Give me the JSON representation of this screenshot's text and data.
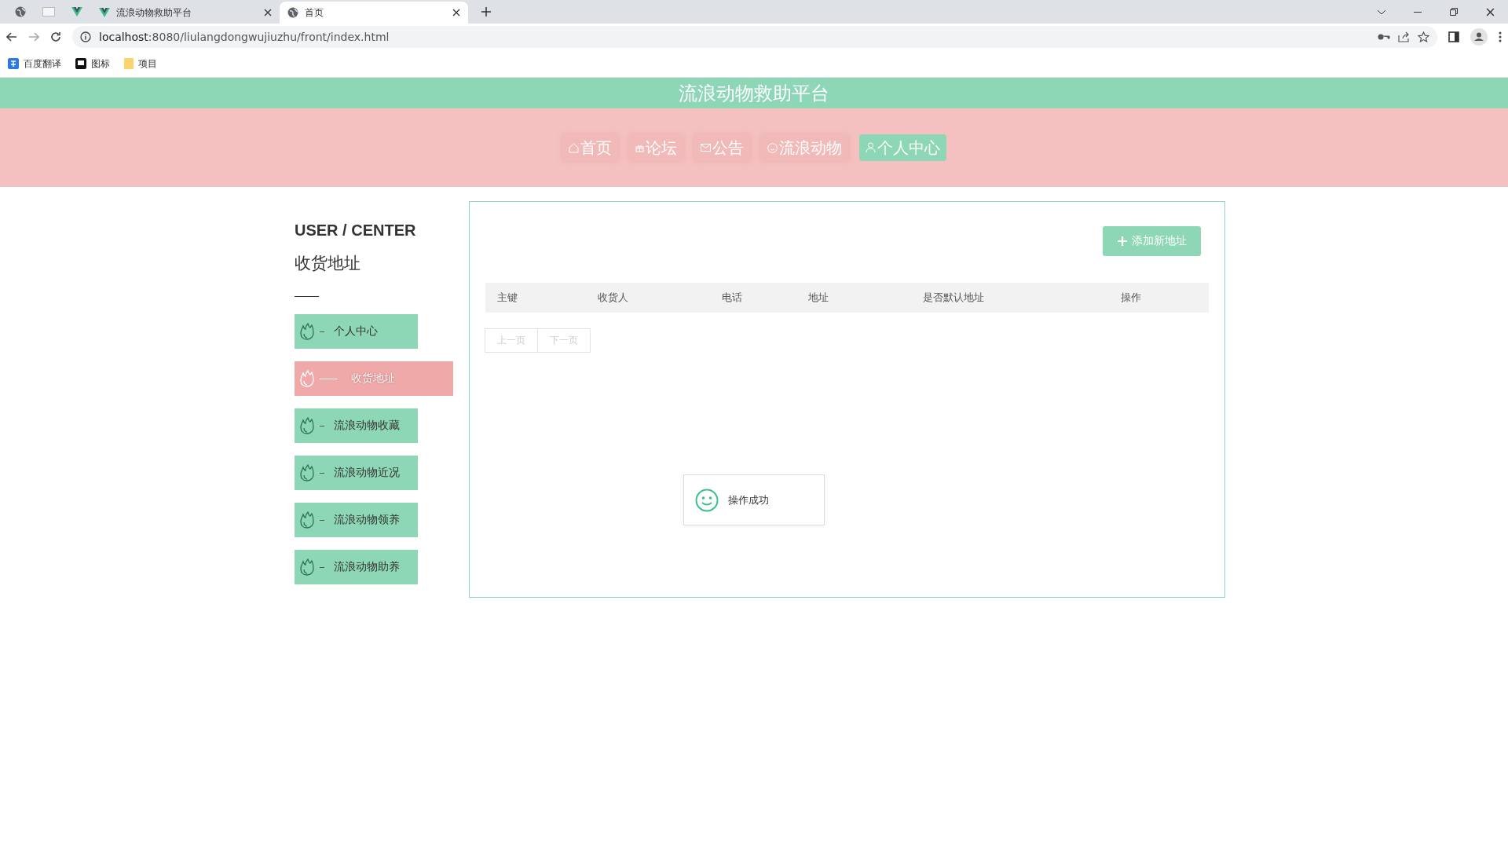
{
  "browser": {
    "tabs": [
      {
        "kind": "pinned",
        "selected": false
      },
      {
        "kind": "pinned",
        "selected": false
      },
      {
        "kind": "pinned",
        "selected": false
      },
      {
        "kind": "full",
        "title": "流浪动物救助平台",
        "selected": false
      },
      {
        "kind": "full",
        "title": "首页",
        "selected": true
      }
    ],
    "address": {
      "host": "localhost",
      "rest": ":8080/liulangdongwujiuzhu/front/index.html"
    },
    "bookmarks": [
      {
        "label": "百度翻译"
      },
      {
        "label": "图标"
      },
      {
        "label": "项目"
      }
    ]
  },
  "site_title": "流浪动物救助平台",
  "nav": [
    {
      "label": "首页",
      "selected": false
    },
    {
      "label": "论坛",
      "selected": false
    },
    {
      "label": "公告",
      "selected": false
    },
    {
      "label": "流浪动物",
      "selected": false
    },
    {
      "label": "个人中心",
      "selected": true
    }
  ],
  "sidebar": {
    "heading": "USER / CENTER",
    "subtitle": "收货地址",
    "items": [
      {
        "label": "个人中心",
        "selected": false
      },
      {
        "label": "收货地址",
        "selected": true
      },
      {
        "label": "流浪动物收藏",
        "selected": false
      },
      {
        "label": "流浪动物近况",
        "selected": false
      },
      {
        "label": "流浪动物领养",
        "selected": false
      },
      {
        "label": "流浪动物助养",
        "selected": false
      }
    ]
  },
  "add_button": "添加新地址",
  "table": {
    "columns": [
      "主键",
      "收货人",
      "电话",
      "地址",
      "是否默认地址",
      "操作"
    ]
  },
  "pager": [
    {
      "label": "上一页",
      "disabled": true
    },
    {
      "label": "下一页",
      "disabled": true
    }
  ],
  "toast": {
    "text": "操作成功"
  }
}
